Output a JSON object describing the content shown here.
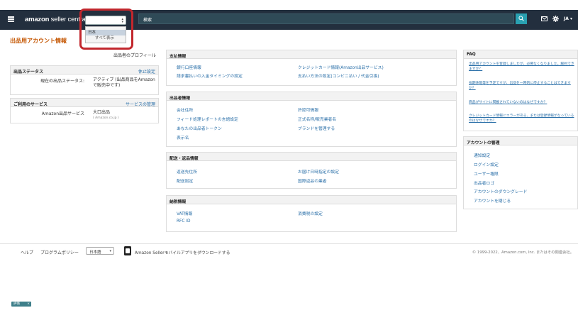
{
  "header": {
    "logo_bold": "amazon",
    "logo_rest": " seller central",
    "marketplace_selected": "日本",
    "marketplace_options": [
      "日本",
      "すべて表示"
    ],
    "search_placeholder": "検索",
    "language": "JA",
    "icons": [
      "menu-icon",
      "search-icon",
      "mail-icon",
      "gear-icon"
    ]
  },
  "page_title": "出品用アカウント情報",
  "left": {
    "profile_link": "出品者のプロフィール",
    "status_panel": {
      "title": "出品ステータス",
      "action": "休止設定",
      "label": "現在の出品ステータス:",
      "value": "アクティブ (出品商品をAmazonで販売中です)"
    },
    "services_panel": {
      "title": "ご利用のサービス",
      "action": "サービスの管理",
      "label": "Amazon出品サービス",
      "value": "大口出品",
      "sub": "( Amazon.co.jp )"
    }
  },
  "middle": {
    "payment": {
      "title": "支払情報",
      "links": [
        "銀行口座情報",
        "クレジットカード情報(Amazon出品サービス)",
        "請求書払いの入金タイミングの設定",
        "支払い方法の設定(コンビニ払い / 代金引換)"
      ]
    },
    "business": {
      "title": "出品者情報",
      "links": [
        "会社住所",
        "許認可情報",
        "フィード処理レポートの言語設定",
        "正式名称/販売業者名",
        "あなたの出品者トークン",
        "ブランドを管理する",
        "表示名"
      ]
    },
    "shipping": {
      "title": "配送・返品情報",
      "links": [
        "返送先住所",
        "お届け日時指定の設定",
        "配送設定",
        "国際返品の業者"
      ]
    },
    "tax": {
      "title": "納税情報",
      "links": [
        "VAT情報",
        "消費税の設定",
        "RFC ID"
      ]
    }
  },
  "right": {
    "faq": {
      "title": "FAQ",
      "items": [
        "出品用アカウントを登録しましたが、必要なくなりました。解約できますか？",
        "長期休暇等を予定ですが、出品を一時的に停止することはできますか？",
        "商品がサイトに掲載されていないのはなぜですか？",
        "クレジットカード情報にエラーがある、または登録情報がなっているのはなぜですか？"
      ]
    },
    "account": {
      "title": "アカウントの管理",
      "items": [
        "通知設定",
        "ログイン設定",
        "ユーザー権限",
        "出品者ロゴ",
        "アカウントのダウングレード",
        "アカウントを閉じる"
      ]
    }
  },
  "footer": {
    "help": "ヘルプ",
    "policy": "プログラムポリシー",
    "language": "日本語",
    "app_text": "Amazon Sellerモバイルアプリをダウンロードする",
    "copyright": "© 1999-2022、Amazon.com, Inc. またはその関連会社。"
  },
  "feedback": {
    "label": "評価",
    "close": "×"
  }
}
